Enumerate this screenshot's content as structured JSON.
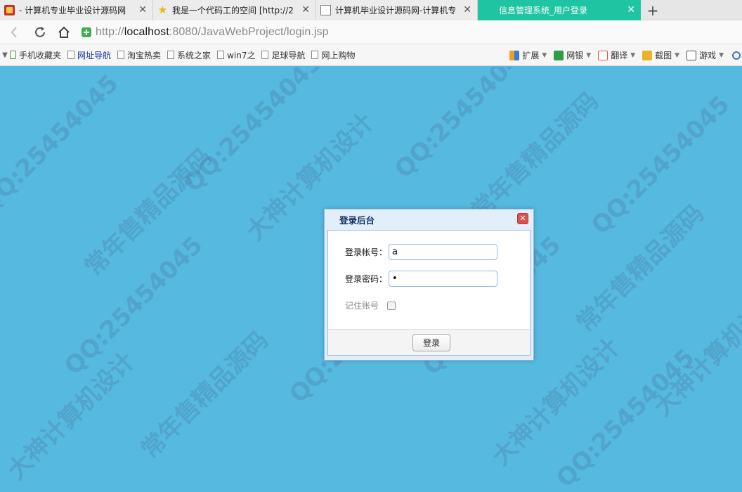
{
  "browser": {
    "tabs": [
      {
        "title": "- 计算机专业毕业设计源码网",
        "favicon": "red-gift-icon",
        "active": false
      },
      {
        "title": "我是一个代码工的空间 [http://2",
        "favicon": "star-icon",
        "active": false
      },
      {
        "title": "计算机毕业设计源码网-计算机专",
        "favicon": "page-icon",
        "active": false
      },
      {
        "title": "信息管理系统_用户登录",
        "favicon": "none",
        "active": true
      }
    ],
    "new_tab_label": "+",
    "close_glyph": "✕",
    "url_scheme": "http://",
    "url_host": "localhost",
    "url_rest": ":8080/JavaWebProject/login.jsp",
    "bookmarks": [
      {
        "label": "手机收藏夹",
        "icon": "phone-icon"
      },
      {
        "label": "网址导航",
        "icon": "page-icon"
      },
      {
        "label": "淘宝热卖",
        "icon": "page-icon"
      },
      {
        "label": "系统之家",
        "icon": "page-icon"
      },
      {
        "label": "win7之",
        "icon": "page-icon"
      },
      {
        "label": "足球导航",
        "icon": "page-icon"
      },
      {
        "label": "网上购物",
        "icon": "page-icon"
      }
    ],
    "tools": [
      {
        "label": "扩展",
        "icon": "extensions-icon"
      },
      {
        "label": "网银",
        "icon": "netbank-icon"
      },
      {
        "label": "翻译",
        "icon": "translate-icon"
      },
      {
        "label": "截图",
        "icon": "screenshot-icon"
      },
      {
        "label": "游戏",
        "icon": "game-icon"
      }
    ]
  },
  "watermark": {
    "texts": [
      "QQ:25454045",
      "QQ:25454045",
      "QQ:25454045",
      "QQ:25454045",
      "QQ:25454045",
      "QQ:25454045",
      "QQ:25454045",
      "QQ:25454045",
      "常年售精品源码",
      "常年售精品源码",
      "常年售精品源码",
      "常年售精品源码",
      "大神计算机设计",
      "大神计算机设计",
      "大神计算机设计",
      "大神计算机设计"
    ]
  },
  "login": {
    "title": "登录后台",
    "close_glyph": "✕",
    "account_label": "登录帐号：",
    "account_value": "a",
    "password_label": "登录密码：",
    "password_value": "a",
    "remember_label": "记住账号",
    "remember_checked": false,
    "submit_label": "登录"
  }
}
